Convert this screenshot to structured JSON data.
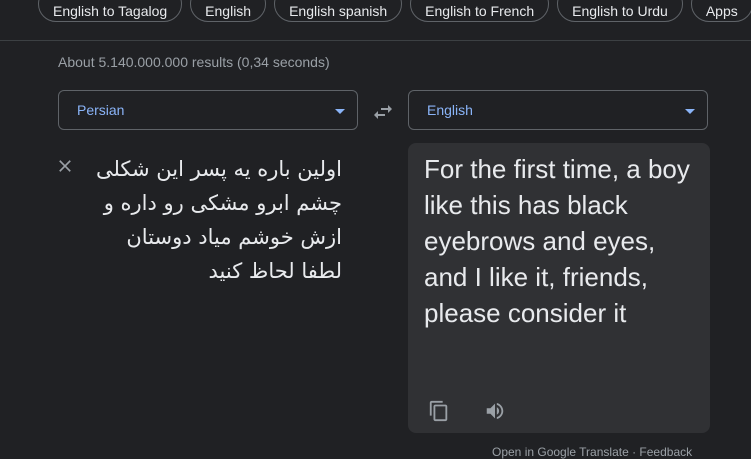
{
  "chips": [
    "English to Tagalog",
    "English",
    "English spanish",
    "English to French",
    "English to Urdu",
    "Apps"
  ],
  "stats": "About 5.140.000.000 results (0,34 seconds)",
  "source": {
    "language": "Persian",
    "text": "اولین باره یه پسر این شکلی چشم ابرو مشکی رو داره و ازش خوشم میاد دوستان لطفا لحاظ کنید"
  },
  "target": {
    "language": "English",
    "text": "For the first time, a boy like this has black eyebrows and eyes, and I like it, friends, please consider it"
  },
  "icons": {
    "swap": "swap-icon",
    "clear": "close-icon",
    "copy": "copy-icon",
    "listen": "speaker-icon"
  },
  "footer": "Open in Google Translate · Feedback"
}
